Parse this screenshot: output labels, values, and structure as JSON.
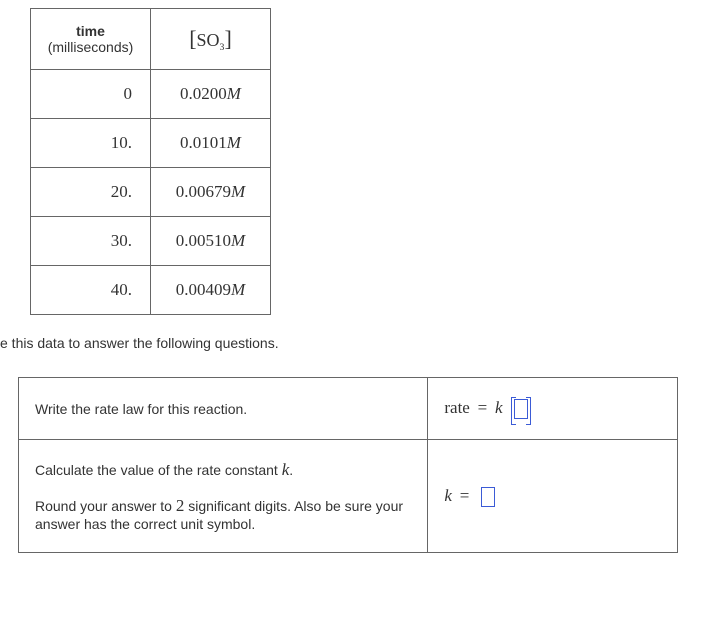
{
  "table_headers": {
    "time_label": "time",
    "time_unit": "(milliseconds)",
    "species_bracket_open": "[",
    "species_formula": "SO",
    "species_sub": "3",
    "species_bracket_close": "]"
  },
  "chart_data": {
    "type": "table",
    "title": "Concentration vs time",
    "xlabel": "time (milliseconds)",
    "ylabel": "[SO3] (M)",
    "categories": [
      0,
      10,
      20,
      30,
      40
    ],
    "values": [
      0.02,
      0.0101,
      0.00679,
      0.0051,
      0.00409
    ]
  },
  "rows": [
    {
      "time": "0",
      "conc": "0.0200",
      "unit": "M"
    },
    {
      "time": "10.",
      "conc": "0.0101",
      "unit": "M"
    },
    {
      "time": "20.",
      "conc": "0.00679",
      "unit": "M"
    },
    {
      "time": "30.",
      "conc": "0.00510",
      "unit": "M"
    },
    {
      "time": "40.",
      "conc": "0.00409",
      "unit": "M"
    }
  ],
  "instruction": "e this data to answer the following questions.",
  "qa": {
    "q1": "Write the rate law for this reaction.",
    "a1_prefix": "rate",
    "a1_eq": "=",
    "a1_k": "k",
    "q2_line1": "Calculate the value of the rate constant ",
    "q2_kvar": "k",
    "q2_line1_end": ".",
    "q2_line2": "Round your answer to ",
    "q2_sig": "2",
    "q2_line2_end": " significant digits. Also be sure your answer has the correct unit symbol.",
    "a2_k": "k",
    "a2_eq": "="
  }
}
